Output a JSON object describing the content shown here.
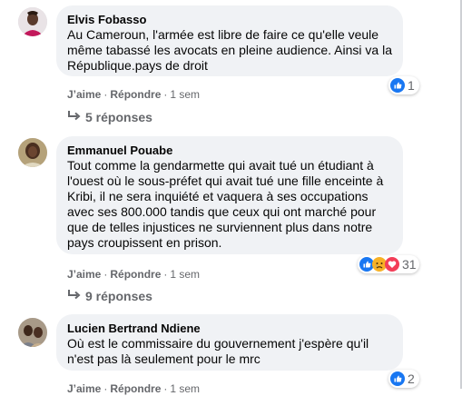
{
  "comments": [
    {
      "author": "Elvis Fobasso",
      "text": "Au Cameroun, l'armée est libre de faire ce qu'elle veule même tabassé les avocats en pleine audience. Ainsi va la République.pays de droit",
      "like_label": "J’aime",
      "reply_label": "Répondre",
      "time": "1 sem",
      "reaction_count": "1",
      "reactions": [
        "like-reaction"
      ],
      "replies_label": "5 réponses"
    },
    {
      "author": "Emmanuel Pouabe",
      "text": "Tout comme la gendarmette qui avait tué un étudiant à l'ouest où le sous-préfet qui avait tué une fille enceinte à Kribi, il ne sera inquiété et vaquera à ses occupations avec ses 800.000 tandis que ceux qui ont marché pour que de telles injustices ne surviennent plus dans notre pays croupissent en prison.",
      "like_label": "J’aime",
      "reply_label": "Répondre",
      "time": "1 sem",
      "reaction_count": "31",
      "reactions": [
        "like-reaction",
        "sad-reaction",
        "love-reaction"
      ],
      "replies_label": "9 réponses"
    },
    {
      "author": "Lucien Bertrand Ndiene",
      "text": "Où est le commissaire du gouvernement j'espère qu'il n'est pas là seulement pour le mrc",
      "like_label": "J’aime",
      "reply_label": "Répondre",
      "time": "1 sem",
      "reaction_count": "2",
      "reactions": [
        "like-reaction"
      ]
    }
  ],
  "colors": {
    "bubble": "#f0f2f5",
    "meta": "#65676b",
    "like_blue": "#1877f2",
    "love_red": "#f33e58",
    "sad_yellow": "#f7b125"
  }
}
